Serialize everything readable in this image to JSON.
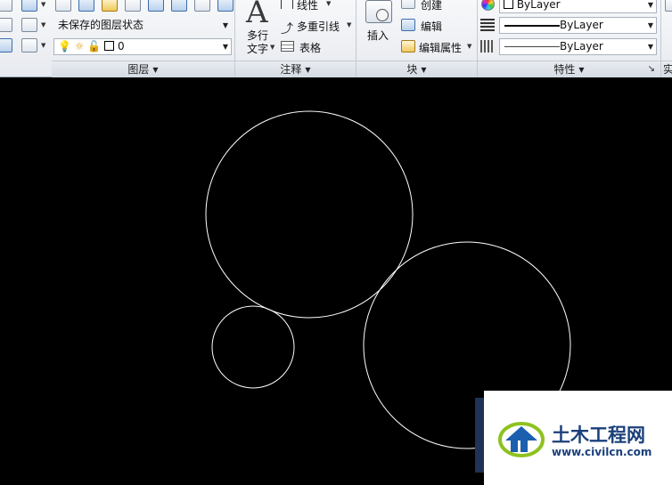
{
  "ribbon": {
    "layer_panel": {
      "state_combo": "未保存的图层状态",
      "layer_combo": "0",
      "footer": "图层"
    },
    "annotation_panel": {
      "multiline_text_label_1": "多行",
      "multiline_text_label_2": "文字",
      "linear_label": "线性",
      "multileader_label": "多重引线",
      "table_label": "表格",
      "footer": "注释"
    },
    "block_panel": {
      "insert_label": "插入",
      "create_label": "创建",
      "edit_label": "编辑",
      "edit_attr_label": "编辑属性",
      "footer": "块"
    },
    "properties_panel": {
      "color_combo": "ByLayer",
      "linetype_combo": "ByLayer",
      "lineweight_combo": "ByLayer",
      "footer": "特性"
    },
    "next_panel_footer": "实"
  },
  "drawing": {
    "background": "#000000",
    "stroke": "#ffffff",
    "circles": [
      {
        "name": "large-upper-circle"
      },
      {
        "name": "small-left-circle"
      },
      {
        "name": "large-lower-right-circle"
      }
    ]
  },
  "watermark": {
    "title": "土木工程网",
    "url": "www.civilcn.com"
  }
}
